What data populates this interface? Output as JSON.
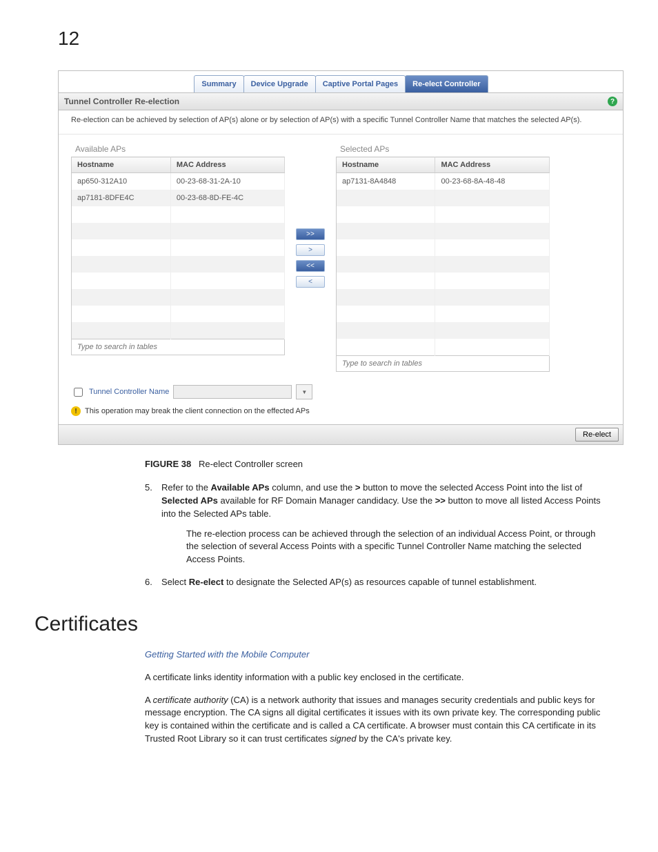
{
  "page_number": "12",
  "tabs": [
    "Summary",
    "Device Upgrade",
    "Captive Portal Pages",
    "Re-elect Controller"
  ],
  "active_tab_index": 3,
  "panel": {
    "title": "Tunnel Controller Re-election",
    "desc": "Re-election can be achieved by selection of AP(s) alone or by selection of AP(s) with a specific Tunnel Controller Name that matches the selected AP(s).",
    "available_title": "Available APs",
    "selected_title": "Selected APs",
    "headers": {
      "hostname": "Hostname",
      "mac": "MAC Address"
    },
    "available": [
      {
        "hostname": "ap650-312A10",
        "mac": "00-23-68-31-2A-10"
      },
      {
        "hostname": "ap7181-8DFE4C",
        "mac": "00-23-68-8D-FE-4C"
      }
    ],
    "selected": [
      {
        "hostname": "ap7131-8A4848",
        "mac": "00-23-68-8A-48-48"
      }
    ],
    "search_placeholder": "Type to search in tables",
    "mover": {
      "all_right": ">>",
      "right": ">",
      "all_left": "<<",
      "left": "<"
    },
    "tcname_label": "Tunnel Controller Name",
    "warning": "This operation may break the client connection on the effected APs",
    "reelect_btn": "Re-elect"
  },
  "caption": {
    "label": "FIGURE 38",
    "text": "Re-elect Controller screen"
  },
  "step5": {
    "num": "5.",
    "pre": "Refer to the ",
    "b1": "Available APs",
    "mid1": " column, and use the ",
    "b2": ">",
    "mid2": " button to move the selected Access Point into the list of ",
    "b3": "Selected APs",
    "mid3": " available for RF Domain Manager candidacy. Use the ",
    "b4": ">>",
    "post": " button to move all listed Access Points into the Selected APs table.",
    "sub": "The re-election process can be achieved through the selection of an individual Access Point, or through the selection of several Access Points with a specific Tunnel Controller Name matching the selected Access Points."
  },
  "step6": {
    "num": "6.",
    "pre": "Select ",
    "b1": "Re-elect",
    "post": " to designate the Selected AP(s) as resources capable of tunnel establishment."
  },
  "section_heading": "Certificates",
  "link_text": "Getting Started with the Mobile Computer",
  "para1": "A certificate links identity information with a public key enclosed in the certificate.",
  "para2": {
    "pre": "A ",
    "term": "certificate authority",
    "mid": " (CA) is a network authority that issues and manages security credentials and public keys for message encryption. The CA signs all digital certificates it issues with its own private key. The corresponding public key is contained within the certificate and is called a CA certificate. A browser must contain this CA certificate in its Trusted Root Library so it can trust certificates ",
    "term2": "signed",
    "post": " by the CA's private key."
  }
}
